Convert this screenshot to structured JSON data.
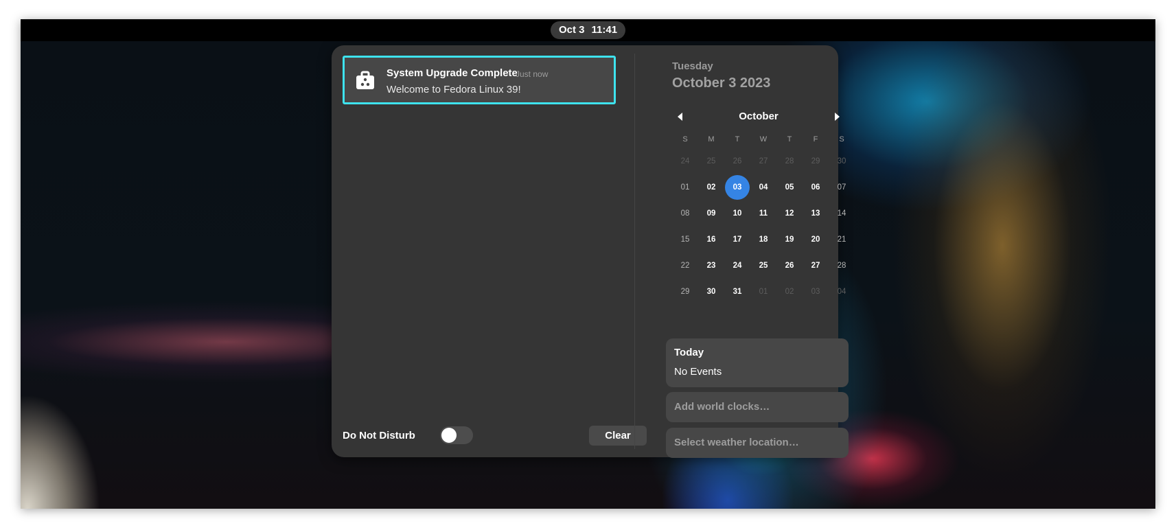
{
  "topbar": {
    "date": "Oct 3",
    "time": "11:41"
  },
  "notification": {
    "icon": "software-package-icon",
    "title": "System Upgrade Complete",
    "time": "Just now",
    "body": "Welcome to Fedora Linux 39!"
  },
  "footer": {
    "dnd_label": "Do Not Disturb",
    "dnd_enabled": false,
    "clear_label": "Clear"
  },
  "calendar": {
    "day_name": "Tuesday",
    "full_date": "October 3 2023",
    "month": "October",
    "weekdays": [
      "S",
      "M",
      "T",
      "W",
      "T",
      "F",
      "S"
    ],
    "days": [
      "24",
      "25",
      "26",
      "27",
      "28",
      "29",
      "30",
      "01",
      "02",
      "03",
      "04",
      "05",
      "06",
      "07",
      "08",
      "09",
      "10",
      "11",
      "12",
      "13",
      "14",
      "15",
      "16",
      "17",
      "18",
      "19",
      "20",
      "21",
      "22",
      "23",
      "24",
      "25",
      "26",
      "27",
      "28",
      "29",
      "30",
      "31",
      "01",
      "02",
      "03",
      "04"
    ],
    "selected": "03"
  },
  "events": {
    "title": "Today",
    "subtitle": "No Events"
  },
  "world_clocks_label": "Add world clocks…",
  "weather_label": "Select weather location…",
  "colors": {
    "accent": "#3584e4",
    "focus_ring": "#3ee3ee",
    "panel": "#353535"
  }
}
